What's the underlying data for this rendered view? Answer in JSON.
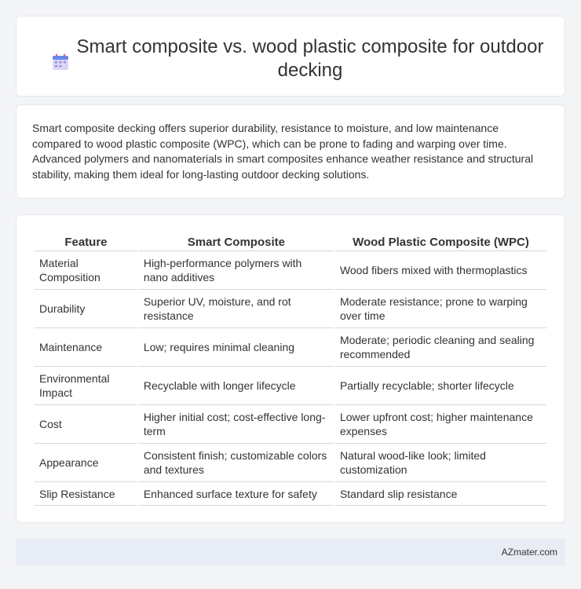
{
  "title": "Smart composite vs. wood plastic composite for outdoor decking",
  "intro": "Smart composite decking offers superior durability, resistance to moisture, and low maintenance compared to wood plastic composite (WPC), which can be prone to fading and warping over time. Advanced polymers and nanomaterials in smart composites enhance weather resistance and structural stability, making them ideal for long-lasting outdoor decking solutions.",
  "table": {
    "headers": [
      "Feature",
      "Smart Composite",
      "Wood Plastic Composite (WPC)"
    ],
    "rows": [
      [
        "Material Composition",
        "High-performance polymers with nano additives",
        "Wood fibers mixed with thermoplastics"
      ],
      [
        "Durability",
        "Superior UV, moisture, and rot resistance",
        "Moderate resistance; prone to warping over time"
      ],
      [
        "Maintenance",
        "Low; requires minimal cleaning",
        "Moderate; periodic cleaning and sealing recommended"
      ],
      [
        "Environmental Impact",
        "Recyclable with longer lifecycle",
        "Partially recyclable; shorter lifecycle"
      ],
      [
        "Cost",
        "Higher initial cost; cost-effective long-term",
        "Lower upfront cost; higher maintenance expenses"
      ],
      [
        "Appearance",
        "Consistent finish; customizable colors and textures",
        "Natural wood-like look; limited customization"
      ],
      [
        "Slip Resistance",
        "Enhanced surface texture for safety",
        "Standard slip resistance"
      ]
    ]
  },
  "footer": "AZmater.com",
  "icon": "calendar-icon"
}
